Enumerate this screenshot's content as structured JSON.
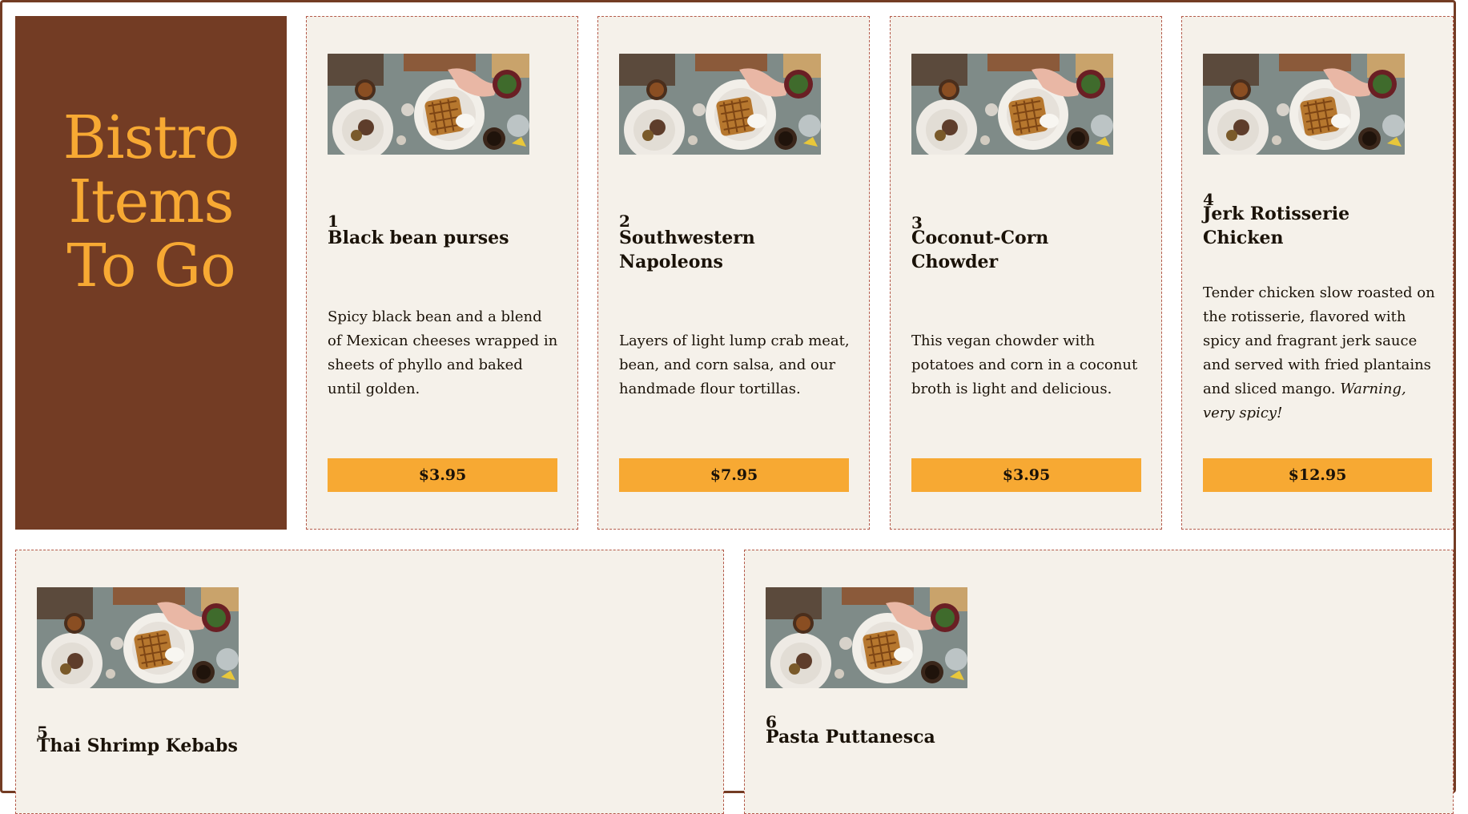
{
  "brand": {
    "line1": "Bistro",
    "line2": "Items",
    "line3": "To Go"
  },
  "items": [
    {
      "number": "1",
      "name": "Black bean purses",
      "description": "Spicy black bean and a blend of Mexican cheeses wrapped in sheets of phyllo and baked until golden.",
      "price": "$3.95"
    },
    {
      "number": "2",
      "name": "Southwestern Napoleons",
      "description": "Layers of light lump crab meat, bean, and corn salsa, and our handmade flour tortillas.",
      "price": "$7.95"
    },
    {
      "number": "3",
      "name": "Coconut-Corn Chowder",
      "description": "This vegan chowder with potatoes and corn in a coconut broth is light and delicious.",
      "price": "$3.95"
    },
    {
      "number": "4",
      "name": "Jerk Rotisserie Chicken",
      "description": "Tender chicken slow roasted on the rotisserie, flavored with spicy and fragrant jerk sauce and served with fried plantains and sliced mango.",
      "warning": "Warning, very spicy!",
      "price": "$12.95"
    },
    {
      "number": "5",
      "name": "Thai Shrimp Kebabs"
    },
    {
      "number": "6",
      "name": "Pasta Puttanesca"
    }
  ],
  "colors": {
    "brown": "#733c24",
    "orange": "#f7a933",
    "card": "#f5f1ea"
  },
  "image_alt": "food-photo"
}
